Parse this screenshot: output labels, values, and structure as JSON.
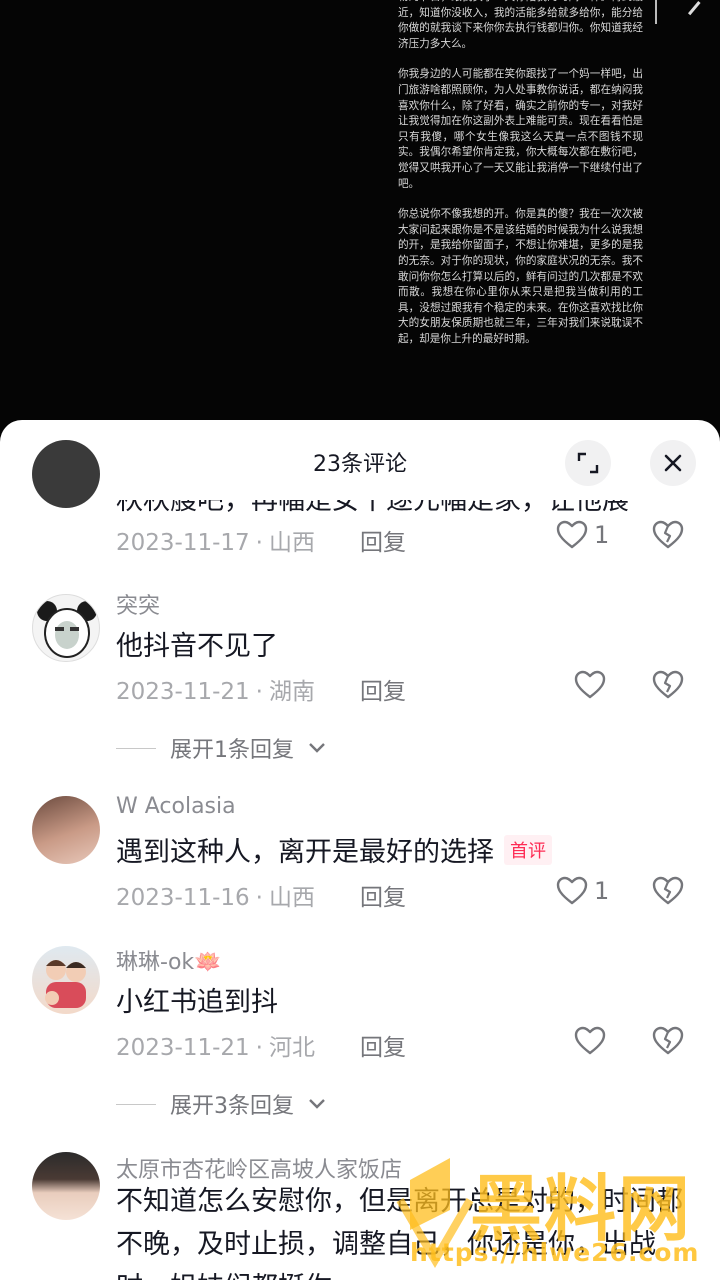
{
  "video": {
    "paragraphs": [
      "物的节日，跟我买了一天你陪我的时间一样。再到最近，知道你没收入，我的活能多给就多给你，能分给你做的就我谈下来你你去执行钱都归你。你知道我经济压力多大么。",
      "你我身边的人可能都在笑你跟找了一个妈一样吧，出门旅游啥都照顾你，为人处事教你说话，都在纳闷我喜欢你什么，除了好看，确实之前你的专一，对我好让我觉得加在你这副外表上难能可贵。现在看看怕是只有我傻，哪个女生像我这么天真一点不图钱不现实。我偶尔希望你肯定我，你大概每次都在敷衍吧，觉得又哄我开心了一天又能让我消停一下继续付出了吧。",
      "你总说你不像我想的开。你是真的傻？我在一次次被大家问起来跟你是不是该结婚的时候我为什么说我想的开，是我给你留面子，不想让你难堪，更多的是我的无奈。对于你的现状，你的家庭状况的无奈。我不敢问你你怎么打算以后的，鲜有问过的几次都是不欢而散。我想在你心里你从来只是把我当做利用的工具，没想过跟我有个稳定的未来。在你这喜欢找比你大的女朋友保质期也就三年，三年对我们来说耽误不起，却是你上升的最好时期。"
    ]
  },
  "sheet": {
    "title": "23条评论",
    "expand_icon": "expand-icon",
    "close_icon": "close-icon"
  },
  "reply_label": "回复",
  "comments": [
    {
      "name": "",
      "text": "秋秋艘吧，再幅是女十逐元幅是家，让他展",
      "date": "2023-11-17",
      "location": "山西",
      "likes": "1"
    },
    {
      "name": "突突",
      "text": "他抖音不见了",
      "date": "2023-11-21",
      "location": "湖南",
      "likes": "",
      "expand": "展开1条回复"
    },
    {
      "name": "W Acolasia",
      "text": "遇到这种人，离开是最好的选择",
      "badge": "首评",
      "date": "2023-11-16",
      "location": "山西",
      "likes": "1"
    },
    {
      "name": "琳琳-ok🪷",
      "text": "小红书追到抖",
      "date": "2023-11-21",
      "location": "河北",
      "likes": "",
      "expand": "展开3条回复"
    },
    {
      "name": "太原市杏花岭区高坡人家饭店",
      "text": "不知道怎么安慰你，但是离开总是对的，时间都不晚，及时止损，调整自己，你还是你，出战时，姐妹们都挺你"
    }
  ],
  "watermark": {
    "text": "黑料网",
    "url": "https://hlwe26.com"
  },
  "colors": {
    "accent": "#fe2c55",
    "watermark": "#ffbe1e"
  }
}
